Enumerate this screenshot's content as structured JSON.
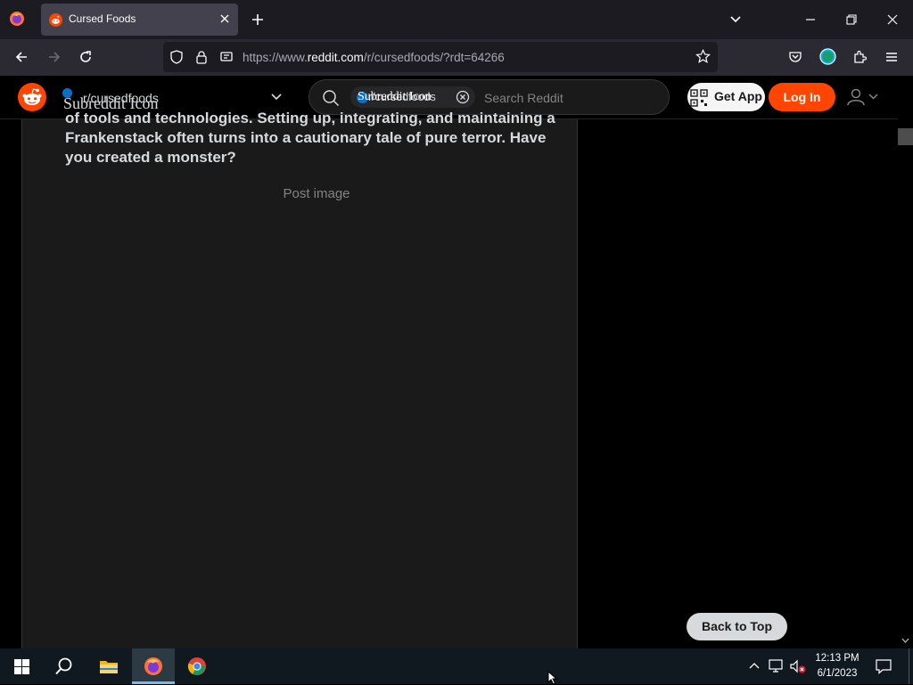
{
  "browser": {
    "tab": {
      "title": "Cursed Foods",
      "favicon": "reddit-favicon-icon"
    },
    "url": {
      "prefix": "https://www.",
      "domain": "reddit.com",
      "path": "/r/cursedfoods/?rdt=64266"
    }
  },
  "reddit": {
    "subreddit": {
      "name": "r/cursedfoods",
      "icon_alt": "Subreddit Icon"
    },
    "search": {
      "chip_name": "r/cursedfoods",
      "chip_icon_alt": "Subreddit Icon",
      "placeholder": "Search Reddit"
    },
    "get_app_label": "Get App",
    "login_label": "Log In"
  },
  "post": {
    "body_text": "of tools and technologies. Setting up, integrating, and maintaining a Frankenstack often turns into a cautionary tale of pure terror. Have you created a monster?",
    "image_alt": "Post image"
  },
  "back_to_top_label": "Back to Top",
  "taskbar": {
    "time": "12:13 PM",
    "date": "6/1/2023"
  },
  "colors": {
    "reddit_orange": "#ff4500",
    "subreddit_blue": "#0a70c6",
    "tab_active": "#42414d",
    "page_bg": "#1a1a1b"
  }
}
